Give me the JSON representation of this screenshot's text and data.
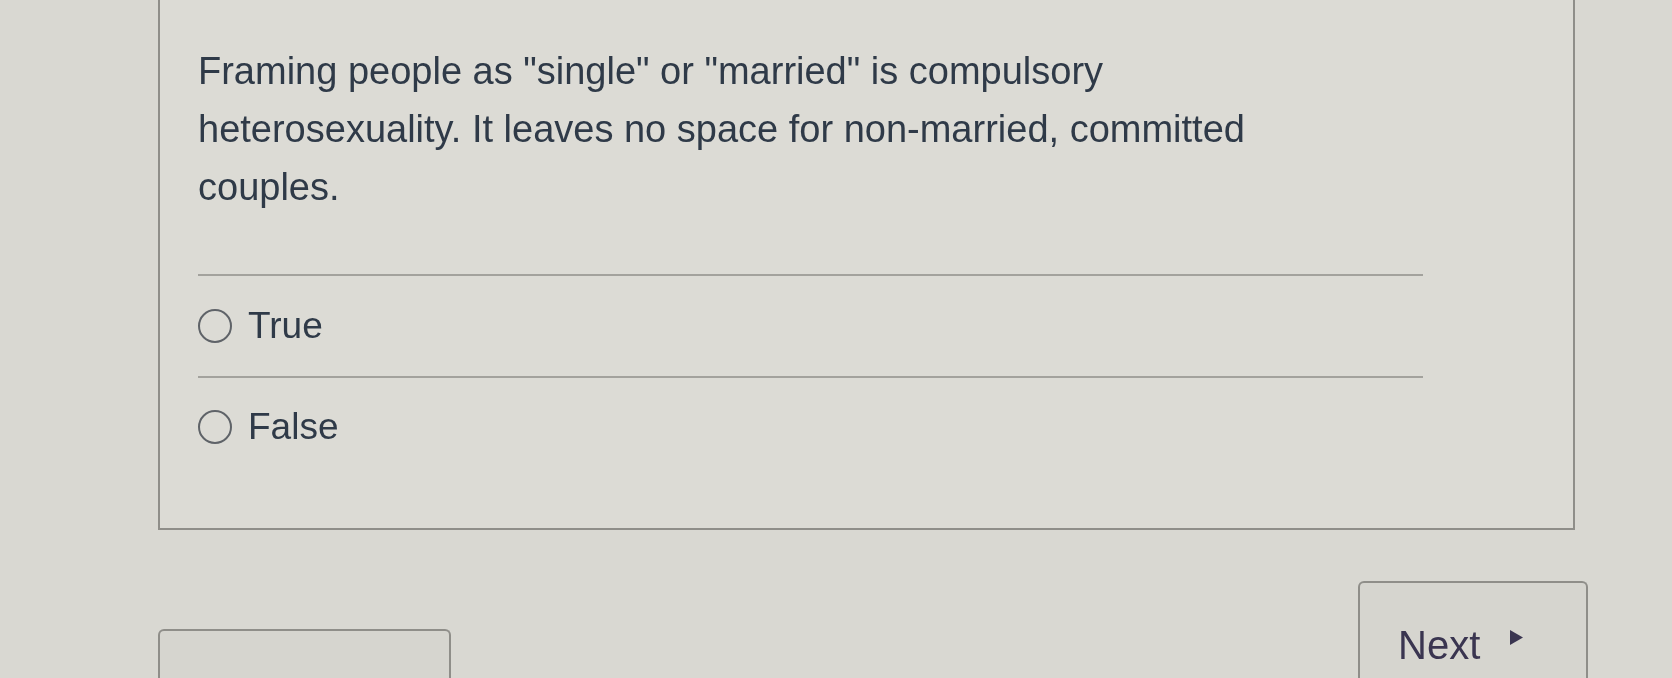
{
  "question": {
    "text": "Framing people as \"single\" or \"married\" is compulsory heterosexuality. It leaves no space for non-married, committed couples."
  },
  "options": [
    {
      "label": "True",
      "selected": false
    },
    {
      "label": "False",
      "selected": false
    }
  ],
  "next_button": {
    "label": "Next"
  }
}
